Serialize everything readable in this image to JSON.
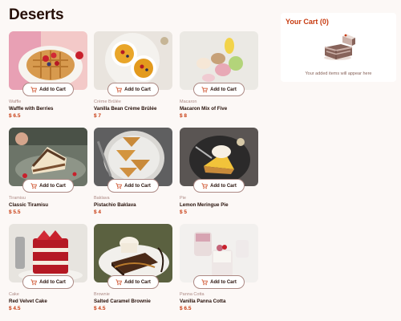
{
  "header": {
    "title": "Deserts"
  },
  "products": [
    {
      "category": "Waffle",
      "name": "Waffle with Berries",
      "price": "$ 6.5",
      "button_label": "Add to Cart"
    },
    {
      "category": "Crème Brûlée",
      "name": "Vanilla Bean Crème Brûlée",
      "price": "$ 7",
      "button_label": "Add to Cart"
    },
    {
      "category": "Macaron",
      "name": "Macaron Mix of Five",
      "price": "$ 8",
      "button_label": "Add to Cart"
    },
    {
      "category": "Tiramisu",
      "name": "Classic Tiramisu",
      "price": "$ 5.5",
      "button_label": "Add to Cart"
    },
    {
      "category": "Baklava",
      "name": "Pistachio Baklava",
      "price": "$ 4",
      "button_label": "Add to Cart"
    },
    {
      "category": "Pie",
      "name": "Lemon Meringue Pie",
      "price": "$ 5",
      "button_label": "Add to Cart"
    },
    {
      "category": "Cake",
      "name": "Red Velvet Cake",
      "price": "$ 4.5",
      "button_label": "Add to Cart"
    },
    {
      "category": "Brownie",
      "name": "Salted Caramel Brownie",
      "price": "$ 4.5",
      "button_label": "Add to Cart"
    },
    {
      "category": "Panna Cotta",
      "name": "Vanilla Panna Cotta",
      "price": "$ 6.5",
      "button_label": "Add to Cart"
    }
  ],
  "cart": {
    "title": "Your Cart (0)",
    "empty_text": "Your added items will appear here"
  },
  "colors": {
    "accent": "#c73a0f",
    "background": "#fcf8f6",
    "text": "#260f08",
    "muted": "#ad8a85"
  }
}
